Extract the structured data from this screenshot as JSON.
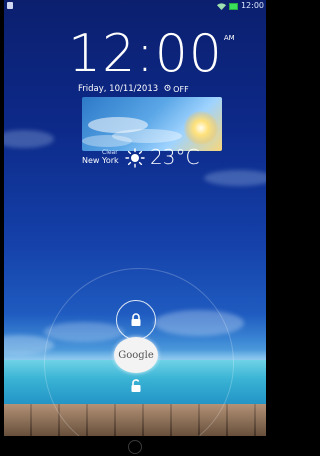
{
  "status_bar": {
    "time": "12:00",
    "signal_icon": "wifi-icon",
    "battery_icon": "battery-icon",
    "notification_icon": "notification-icon"
  },
  "clock": {
    "time": "12:00",
    "ampm": "AM"
  },
  "date": {
    "text": "Friday, 10/11/2013",
    "alarm_icon": "alarm-icon",
    "alarm_label": "OFF"
  },
  "weather": {
    "condition": "Clear",
    "city": "New York",
    "temperature": "23°C",
    "icon": "sun-icon"
  },
  "unlock": {
    "lock_icon_top": "lock-icon",
    "google_label": "Google",
    "lock_icon_bottom": "unlock-icon"
  },
  "colors": {
    "sky_top": "#0b1f6e",
    "sea": "#39b3d5",
    "battery": "#3be05a"
  }
}
